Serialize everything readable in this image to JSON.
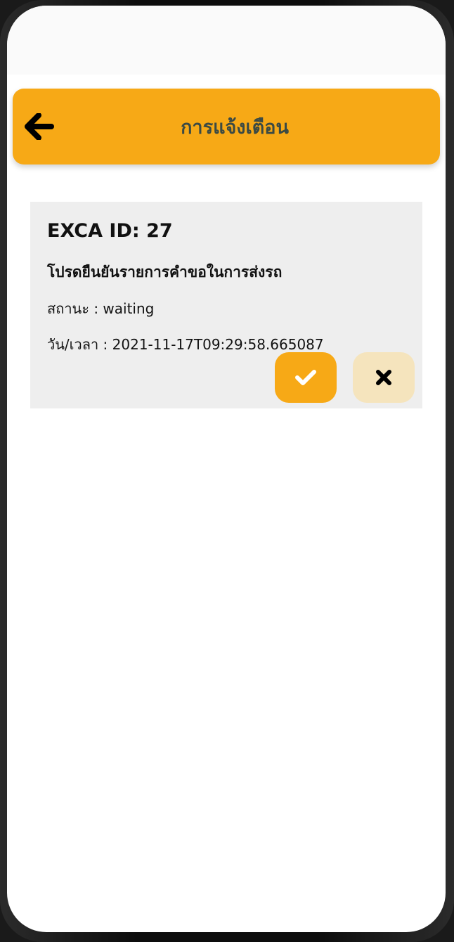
{
  "app_bar": {
    "title": "การแจ้งเตือน",
    "back_icon": "arrow-left-icon",
    "background": "#f7a916",
    "title_color": "#3b4a44"
  },
  "notification": {
    "id_label": "EXCA ID: 27",
    "message": "โปรดยืนยันรายการคำขอในการส่งรถ",
    "status_text": "สถานะ : waiting",
    "datetime_text": "วัน/เวลา : 2021-11-17T09:29:58.665087",
    "confirm_icon": "check-icon",
    "reject_icon": "close-icon",
    "confirm_color": "#f7a916",
    "reject_color": "#f5e4bd"
  }
}
